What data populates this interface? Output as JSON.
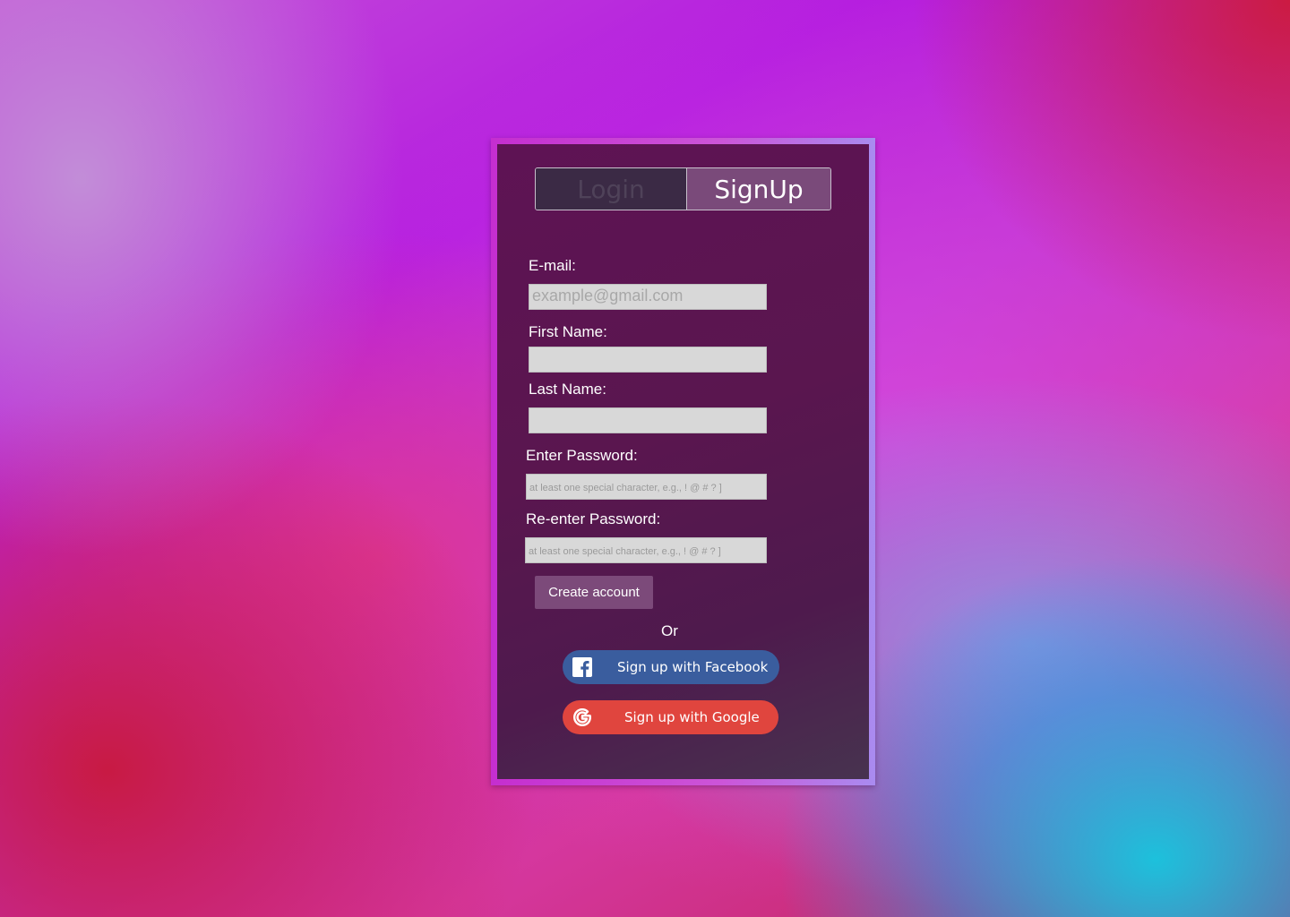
{
  "tabs": {
    "login": "Login",
    "signup": "SignUp"
  },
  "form": {
    "email_label": "E-mail:",
    "email_placeholder": "example@gmail.com",
    "first_name_label": "First Name:",
    "last_name_label": "Last Name:",
    "password_label": "Enter Password:",
    "password_placeholder": "at least one special character, e.g., ! @ # ? ]",
    "reenter_password_label": "Re-enter Password:",
    "reenter_password_placeholder": "at least one special character, e.g., ! @ # ? ]",
    "create_button": "Create account",
    "or_text": "Or"
  },
  "social": {
    "facebook_label": "Sign up with Facebook",
    "facebook_icon": "facebook-icon",
    "facebook_color": "#3a5d9e",
    "google_label": "Sign up with Google",
    "google_icon": "google-icon",
    "google_color": "#e0453e"
  },
  "colors": {
    "active_tab": "#7a4a7a",
    "inactive_tab": "#3b2a45",
    "card_background": "#5a164f",
    "card_border": "#c52ed0"
  }
}
